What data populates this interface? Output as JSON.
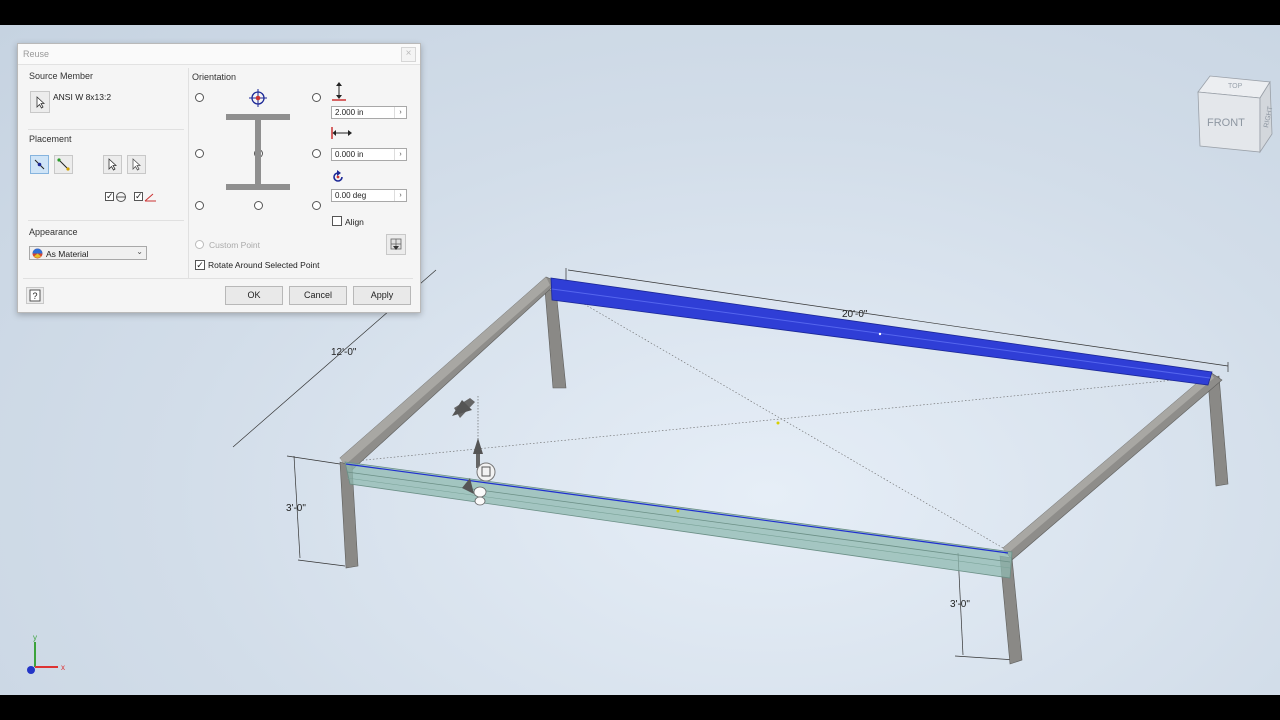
{
  "dialog": {
    "title": "Reuse",
    "close_label": "×",
    "source_member": {
      "label": "Source Member",
      "value": "ANSI W 8x13:2"
    },
    "placement": {
      "label": "Placement"
    },
    "appearance": {
      "label": "Appearance",
      "selected": "As Material"
    },
    "orientation": {
      "label": "Orientation",
      "offset_y": "2.000 in",
      "offset_x": "0.000 in",
      "rotation": "0.00 deg",
      "align_label": "Align",
      "custom_point_label": "Custom Point",
      "rotate_label": "Rotate Around Selected Point",
      "rotate_checked": true
    },
    "buttons": {
      "ok": "OK",
      "cancel": "Cancel",
      "apply": "Apply"
    }
  },
  "viewcube": {
    "top": "TOP",
    "front": "FRONT",
    "right": "RIGHT"
  },
  "dimensions": {
    "length": "20'-0\"",
    "width": "12'-0\"",
    "height_left": "3'-0\"",
    "height_right": "3'-0\""
  },
  "triad": {
    "x": "x",
    "y": "y"
  },
  "colors": {
    "selected_member": "#2f3ed6",
    "preview_member": "#8fb9b0",
    "frame_member": "#8a8986"
  }
}
